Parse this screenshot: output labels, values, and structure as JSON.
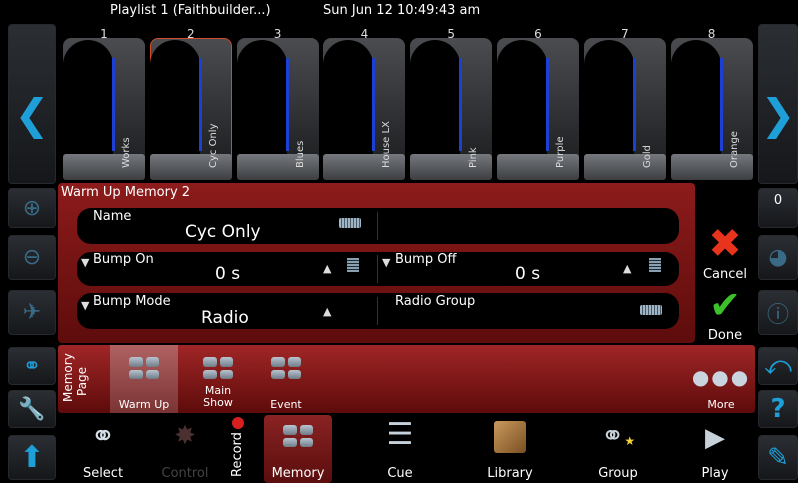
{
  "header": {
    "playlist": "Playlist 1 (Faithbuilder...)",
    "clock": "Sun Jun 12 10:49:43 am"
  },
  "faders": [
    {
      "number": "1",
      "name": "Works"
    },
    {
      "number": "2",
      "name": "Cyc Only",
      "selected": true
    },
    {
      "number": "3",
      "name": "Blues"
    },
    {
      "number": "4",
      "name": "House LX"
    },
    {
      "number": "5",
      "name": "Pink"
    },
    {
      "number": "6",
      "name": "Purple"
    },
    {
      "number": "7",
      "name": "Gold"
    },
    {
      "number": "8",
      "name": "Orange"
    }
  ],
  "right_side": {
    "counter": "0"
  },
  "dialog": {
    "title": "Warm Up Memory 2",
    "name_label": "Name",
    "name_value": "Cyc Only",
    "bump_on_label": "Bump On",
    "bump_on_value": "0 s",
    "bump_off_label": "Bump Off",
    "bump_off_value": "0 s",
    "bump_mode_label": "Bump Mode",
    "bump_mode_value": "Radio",
    "radio_group_label": "Radio Group",
    "cancel_label": "Cancel",
    "done_label": "Done"
  },
  "memory_page": {
    "label_line1": "Memory",
    "label_line2": "Page",
    "pages": [
      "Warm Up",
      "Main Show",
      "Event"
    ],
    "active_page": "Warm Up",
    "more_label": "More"
  },
  "nav": {
    "items": [
      "Select",
      "Control",
      "Record",
      "Memory",
      "Cue",
      "Library",
      "Group",
      "Play"
    ],
    "active": "Memory"
  },
  "colors": {
    "accent_blue": "#1f9fd8",
    "dialog_red": "#8d1b1b",
    "cancel_red": "#e8341c",
    "done_green": "#3cc12b"
  }
}
